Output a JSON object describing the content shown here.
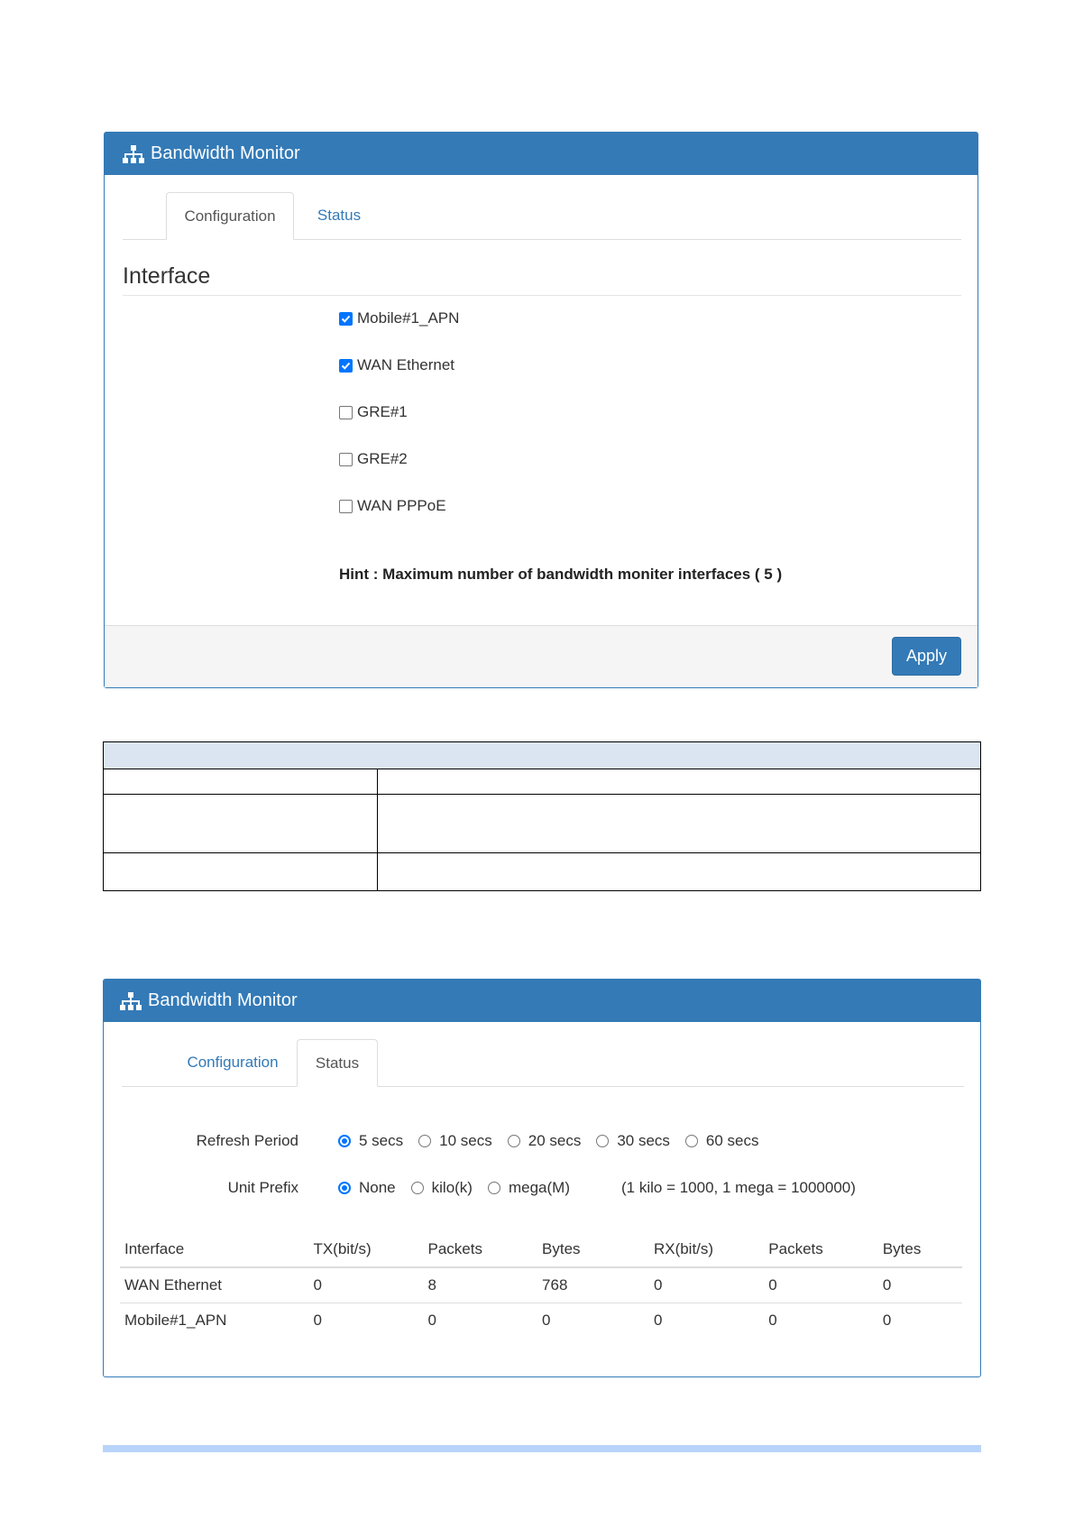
{
  "config_panel": {
    "title": "Bandwidth Monitor",
    "tabs": [
      {
        "label": "Configuration",
        "active": true
      },
      {
        "label": "Status",
        "active": false
      }
    ],
    "section_title": "Interface",
    "interfaces": [
      {
        "label": "Mobile#1_APN",
        "checked": true
      },
      {
        "label": "WAN Ethernet",
        "checked": true
      },
      {
        "label": "GRE#1",
        "checked": false
      },
      {
        "label": "GRE#2",
        "checked": false
      },
      {
        "label": "WAN PPPoE",
        "checked": false
      }
    ],
    "hint": "Hint : Maximum number of bandwidth moniter interfaces ( 5 )",
    "apply_label": "Apply"
  },
  "status_panel": {
    "title": "Bandwidth Monitor",
    "tabs": [
      {
        "label": "Configuration",
        "active": false
      },
      {
        "label": "Status",
        "active": true
      }
    ],
    "refresh": {
      "label": "Refresh Period",
      "options": [
        "5 secs",
        "10 secs",
        "20 secs",
        "30 secs",
        "60 secs"
      ],
      "selected": "5 secs"
    },
    "unit": {
      "label": "Unit Prefix",
      "options": [
        "None",
        "kilo(k)",
        "mega(M)"
      ],
      "selected": "None",
      "note": "(1 kilo = 1000, 1 mega = 1000000)"
    },
    "table": {
      "headers": [
        "Interface",
        "TX(bit/s)",
        "Packets",
        "Bytes",
        "RX(bit/s)",
        "Packets",
        "Bytes"
      ],
      "rows": [
        [
          "WAN Ethernet",
          "0",
          "8",
          "768",
          "0",
          "0",
          "0"
        ],
        [
          "Mobile#1_APN",
          "0",
          "0",
          "0",
          "0",
          "0",
          "0"
        ]
      ]
    }
  },
  "colors": {
    "primary": "#337ab7",
    "checkbox_accent": "#0075ff",
    "doc_table_header": "#dbe5f1"
  }
}
